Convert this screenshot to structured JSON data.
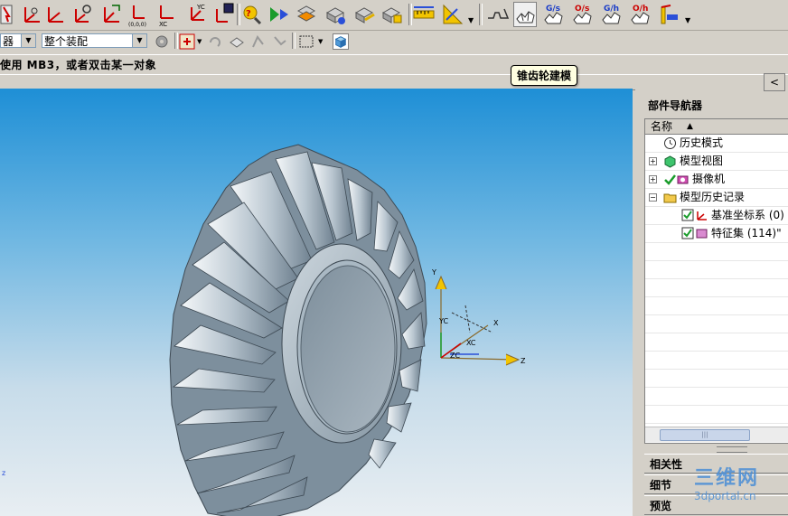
{
  "toolbar": {
    "tooltip": "锥齿轮建模",
    "buttons": [
      "select-icon",
      "csys-icon",
      "csys-origin-icon",
      "csys-rotate-icon",
      "csys-dynamic-icon",
      "csys-000-icon",
      "csys-xc-icon",
      "csys-yc-icon",
      "save-csys-icon",
      "expression-icon",
      "play-icon",
      "feature-icon",
      "assembly-icon",
      "assembly-edit-icon",
      "assembly-box-icon",
      "measure-distance-icon",
      "measure-angle-icon",
      "spur-gear-icon",
      "bevel-gear-icon",
      "gear-gs-icon",
      "gear-os-icon",
      "gear-gh-icon",
      "gear-oh-icon",
      "gear-display-icon"
    ],
    "gear_labels": [
      "G/s",
      "O/s",
      "G/h",
      "O/h"
    ]
  },
  "toolbar2": {
    "filter_value": "器",
    "scope_value": "整个装配"
  },
  "status": {
    "text": "使用 MB3，或者双击某一对象"
  },
  "viewport": {
    "triad_labels": {
      "x": "X",
      "y": "Y",
      "z": "Z",
      "xc": "XC",
      "yc": "YC",
      "zc": "ZC"
    },
    "corner_label": "z"
  },
  "navigator": {
    "collapse": "<",
    "title": "部件导航器",
    "column_header": "名称",
    "sort_arrow": "▲",
    "rows": [
      {
        "label": "历史模式",
        "icon": "clock-icon"
      },
      {
        "label": "模型视图",
        "icon": "model-view-icon"
      },
      {
        "label": "摄像机",
        "icon": "camera-icon"
      },
      {
        "label": "模型历史记录",
        "icon": "folder-icon"
      },
      {
        "label": "基准坐标系 (0)",
        "icon": "datum-csys-icon"
      },
      {
        "label": "特征集 (114)\"",
        "icon": "feature-set-icon"
      }
    ],
    "panels": [
      "相关性",
      "细节",
      "预览"
    ]
  },
  "watermark": {
    "main": "三维网",
    "url": "3dportal.cn"
  },
  "colors": {
    "sky_top": "#1e8fd6",
    "sky_bottom": "#e8eef2",
    "gear": "#8fa1b0",
    "tooltip_bg": "#ffffe1"
  }
}
